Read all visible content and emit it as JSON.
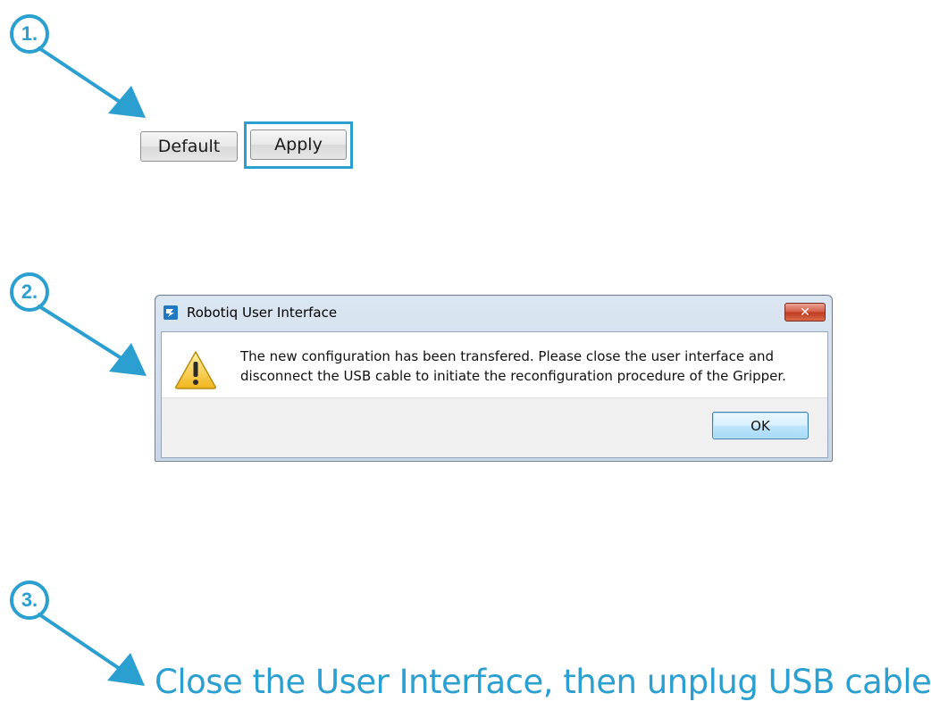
{
  "steps": {
    "step1": {
      "number": "1."
    },
    "step2": {
      "number": "2."
    },
    "step3": {
      "number": "3."
    }
  },
  "buttons": {
    "default_label": "Default",
    "apply_label": "Apply"
  },
  "dialog": {
    "title": "Robotiq User Interface",
    "close_glyph": "✕",
    "message_line1": "The new configuration has been transfered. Please close the user interface and",
    "message_line2": "disconnect the USB cable to initiate the reconfiguration procedure of the Gripper.",
    "ok_label": "OK",
    "icon": "warning-icon"
  },
  "instruction_text": "Close the User Interface, then unplug USB cable.",
  "colors": {
    "accent": "#2a9fd0",
    "warning": "#f1c232",
    "close_button": "#c9472f"
  }
}
